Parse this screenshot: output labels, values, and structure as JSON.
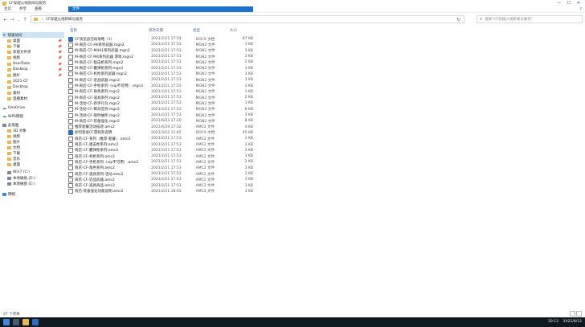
{
  "window": {
    "title": "CF穿越火线新闻与服务",
    "controls": [
      "—",
      "☐",
      "✕"
    ]
  },
  "ribbon": {
    "tabs": [
      "文件",
      "主页",
      "共享",
      "查看"
    ],
    "help": "?"
  },
  "address": {
    "crumbs": [
      "CF穿越火线新闻与服务"
    ],
    "search_placeholder": "搜索\"CF穿越火线新闻与服务\""
  },
  "columns": {
    "name": "名称",
    "date": "修改日期",
    "type": "类型",
    "size": "大小"
  },
  "sidebar": {
    "items": [
      {
        "label": "快速访问",
        "icon": "star-icon",
        "selected": true
      },
      {
        "label": "桌面",
        "icon": "desktop-icon",
        "pinned": true
      },
      {
        "label": "下载",
        "icon": "download-icon",
        "pinned": true
      },
      {
        "label": "新建文件夹",
        "icon": "folder-icon",
        "pinned": true
      },
      {
        "label": "视频",
        "icon": "video-icon",
        "pinned": true
      },
      {
        "label": "UserData",
        "icon": "folder-icon",
        "pinned": true
      },
      {
        "label": "Desktop",
        "icon": "folder-icon",
        "pinned": true
      },
      {
        "label": "图片",
        "icon": "picture-icon",
        "pinned": true
      },
      {
        "label": "2021-07",
        "icon": "folder-icon"
      },
      {
        "label": "Desktop",
        "icon": "folder-icon"
      },
      {
        "label": "素材",
        "icon": "folder-icon"
      },
      {
        "label": "直播素材",
        "icon": "folder-icon"
      },
      {
        "label": "OneDrive",
        "icon": "cloud-icon"
      },
      {
        "label": "WPS网盘",
        "icon": "cloud-icon"
      },
      {
        "label": "此电脑",
        "icon": "computer-icon"
      },
      {
        "label": "3D 对象",
        "icon": "cube-icon"
      },
      {
        "label": "视频",
        "icon": "video-icon"
      },
      {
        "label": "图片",
        "icon": "picture-icon"
      },
      {
        "label": "文档",
        "icon": "document-icon"
      },
      {
        "label": "下载",
        "icon": "download-icon"
      },
      {
        "label": "音乐",
        "icon": "music-icon"
      },
      {
        "label": "桌面",
        "icon": "desktop-icon"
      },
      {
        "label": "Win7 (C:)",
        "icon": "drive-icon"
      },
      {
        "label": "本地磁盘 (D:)",
        "icon": "drive-icon"
      },
      {
        "label": "本地磁盘 (E:)",
        "icon": "drive-icon"
      },
      {
        "label": "网络",
        "icon": "network-icon"
      }
    ]
  },
  "files": [
    {
      "name": "CF攻坚战活动攻略（1）",
      "date": "2021/2/21 17:54",
      "type": "DOCX 文档",
      "size": "87 KB",
      "kind": "docx"
    },
    {
      "name": "M-商店-CF-AK系列武器.mgn2",
      "date": "2021/2/21 17:53",
      "type": "MGN2 文件",
      "size": "3 KB",
      "kind": "mgn"
    },
    {
      "name": "M-商店-CF-M4A1系列武器.mgn2",
      "date": "2021/2/21 17:53",
      "type": "MGN2 文件",
      "size": "3 KB",
      "kind": "mgn"
    },
    {
      "name": "M-商店-CF M4系列武器 游戏.mgn2",
      "date": "2021/2/21 17:53",
      "type": "MGN2 文件",
      "size": "3 KB",
      "kind": "mgn"
    },
    {
      "name": "M-商店-CF-狙击枪系列.mgn2",
      "date": "2021/2/21 17:53",
      "type": "MGN2 文件",
      "size": "2 KB",
      "kind": "mgn"
    },
    {
      "name": "M-商店-CF-霰弹枪系列.mgn2",
      "date": "2021/2/21 17:53",
      "type": "MGN2 文件",
      "size": "3 KB",
      "kind": "mgn"
    },
    {
      "name": "M-商店-CF-机枪系列武器.mgn2",
      "date": "2021/2/21 17:53",
      "type": "MGN2 文件",
      "size": "3 KB",
      "kind": "mgn"
    },
    {
      "name": "M-商店-CF-近战武器.mgn2",
      "date": "2021/2/21 17:53",
      "type": "MGN2 文件",
      "size": "3 KB",
      "kind": "mgn"
    },
    {
      "name": "M-商店-CF-手枪系列（vip不可用）.mgn2",
      "date": "2021/2/21 17:53",
      "type": "MGN2 文件",
      "size": "3 KB",
      "kind": "mgn"
    },
    {
      "name": "M-商店-CF-角色系列.mgn2",
      "date": "2021/2/21 17:53",
      "type": "MGN2 文件",
      "size": "3 KB",
      "kind": "mgn"
    },
    {
      "name": "M-商店-CF-道具系列.mgn2",
      "date": "2021/2/21 17:53",
      "type": "MGN2 文件",
      "size": "2 KB",
      "kind": "mgn"
    },
    {
      "name": "M-活动-CF-新手礼包.mgn2",
      "date": "2021/2/21 17:53",
      "type": "MGN2 文件",
      "size": "3 KB",
      "kind": "mgn"
    },
    {
      "name": "M-活动-CF-每日签到.mgn2",
      "date": "2021/2/21 17:53",
      "type": "MGN2 文件",
      "size": "6 KB",
      "kind": "mgn"
    },
    {
      "name": "M-活动-CF-限时抽奖.mgn2",
      "date": "2021/2/21 17:53",
      "type": "MGN2 文件",
      "size": "3 KB",
      "kind": "mgn"
    },
    {
      "name": "M-商店-CF-装备强化.mgn2",
      "date": "2021/6/23 17:20",
      "type": "MGN2 文件",
      "size": "8 KB",
      "kind": "mgn"
    },
    {
      "name": "推荐套餐活动描述.amc2",
      "date": "2021/4/29 17:32",
      "type": "AMC2 文件",
      "size": "4 KB",
      "kind": "mgn"
    },
    {
      "name": "如何登录CF游戏及说明",
      "date": "2021/3/15 11:45",
      "type": "DOCX 文档",
      "size": "45 KB",
      "kind": "docx"
    },
    {
      "name": "商店-CF-系列（推荐·套餐）.amc2",
      "date": "2021/2/21 17:53",
      "type": "AMC2 文件",
      "size": "3 KB",
      "kind": "mgn"
    },
    {
      "name": "商店-CF-狙击枪系列.amc2",
      "date": "2021/2/21 17:53",
      "type": "AMC2 文件",
      "size": "3 KB",
      "kind": "mgn"
    },
    {
      "name": "商店-CF-霰弹枪系列.amc2",
      "date": "2021/2/21 17:53",
      "type": "AMC2 文件",
      "size": "3 KB",
      "kind": "mgn"
    },
    {
      "name": "商店-CF-机枪系列.amc2",
      "date": "2021/2/21 17:53",
      "type": "AMC2 文件",
      "size": "3 KB",
      "kind": "mgn"
    },
    {
      "name": "商店-CF-手枪系列（vip不可用）.amc2",
      "date": "2021/2/21 17:53",
      "type": "AMC2 文件",
      "size": "2 KB",
      "kind": "mgn"
    },
    {
      "name": "商店-CF-角色系列.amc2",
      "date": "2021/2/21 17:53",
      "type": "AMC2 文件",
      "size": "3 KB",
      "kind": "mgn"
    },
    {
      "name": "商店-CF-道具系列-活动.amc2",
      "date": "2021/2/21 17:53",
      "type": "AMC2 文件",
      "size": "3 KB",
      "kind": "mgn"
    },
    {
      "name": "商店-CF-近战武器.amc2",
      "date": "2021/2/21 17:53",
      "type": "AMC2 文件",
      "size": "3 KB",
      "kind": "mgn"
    },
    {
      "name": "商店-CF-道具商品.amc2",
      "date": "2021/2/21 17:53",
      "type": "AMC2 文件",
      "size": "3 KB",
      "kind": "mgn"
    },
    {
      "name": "商店-装备强化功能说明.amc2",
      "date": "2021/2/21 18:05",
      "type": "AMC2 文件",
      "size": "3 KB",
      "kind": "mgn"
    }
  ],
  "status": {
    "count": "27 个项目"
  },
  "taskbar": {
    "time": "20:13",
    "date": "2021/8/12"
  }
}
